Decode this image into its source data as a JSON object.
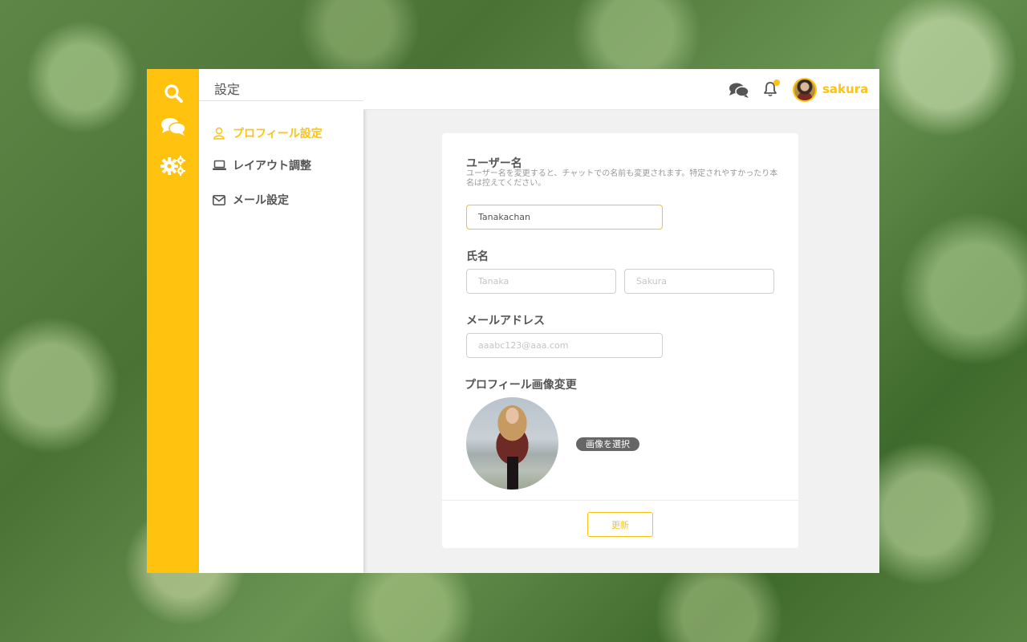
{
  "colors": {
    "accent": "#fec20f",
    "text": "#555555"
  },
  "rail": {
    "icons": [
      "search-icon",
      "chat-icon",
      "gears-icon"
    ]
  },
  "menu": {
    "title": "設定",
    "items": [
      {
        "label": "プロフィール設定",
        "icon": "user-icon",
        "active": true
      },
      {
        "label": "レイアウト調整",
        "icon": "laptop-icon",
        "active": false
      },
      {
        "label": "メール設定",
        "icon": "envelope-icon",
        "active": false
      }
    ]
  },
  "header": {
    "username": "sakura",
    "icons": [
      "chat-icon",
      "bell-icon"
    ]
  },
  "form": {
    "username_label": "ユーザー名",
    "username_help": "ユーザー名を変更すると、チャットでの名前も変更されます。特定されやすかったり本名は控えてください。",
    "username_value": "Tanakachan",
    "name_label": "氏名",
    "last_name_placeholder": "Tanaka",
    "first_name_placeholder": "Sakura",
    "email_label": "メールアドレス",
    "email_placeholder": "aaabc123@aaa.com",
    "image_label": "プロフィール画像変更",
    "select_image_label": "画像を選択",
    "update_label": "更新"
  }
}
